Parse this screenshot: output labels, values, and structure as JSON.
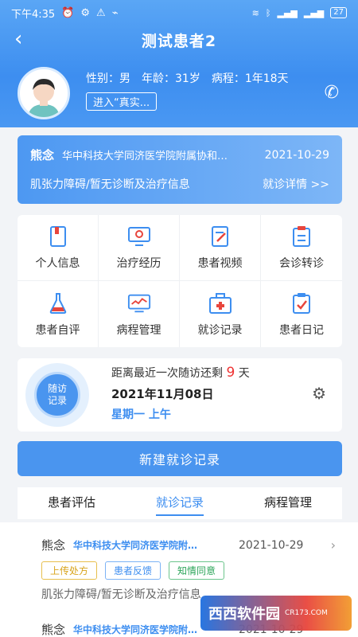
{
  "status_bar": {
    "time": "下午4:35",
    "battery": "27"
  },
  "nav": {
    "back_icon": "chevron-left-icon",
    "title": "测试患者2"
  },
  "patient": {
    "gender_label": "性别：男",
    "age_label": "年龄：31岁",
    "course_label": "病程：1年18天",
    "enter_button": "进入“真实..."
  },
  "latest_visit": {
    "name": "熊念",
    "hospital": "华中科技大学同济医学院附属协和…",
    "date": "2021-10-29",
    "diagnosis": "肌张力障碍/暂无诊断及治疗信息",
    "detail_link": "就诊详情 >>"
  },
  "menu": [
    {
      "label": "个人信息",
      "icon": "book-icon"
    },
    {
      "label": "治疗经历",
      "icon": "monitor-icon"
    },
    {
      "label": "患者视频",
      "icon": "edit-document-icon"
    },
    {
      "label": "会诊转诊",
      "icon": "clipboard-icon"
    },
    {
      "label": "患者自评",
      "icon": "flask-icon"
    },
    {
      "label": "病程管理",
      "icon": "chart-screen-icon"
    },
    {
      "label": "就诊记录",
      "icon": "medical-kit-icon"
    },
    {
      "label": "患者日记",
      "icon": "checklist-icon"
    }
  ],
  "followup": {
    "badge_line1": "随访",
    "badge_line2": "记录",
    "countdown_prefix": "距离最近一次随访还剩",
    "countdown_days": "9",
    "countdown_unit": "天",
    "date": "2021年11月08日",
    "weekday": "星期一 上午"
  },
  "new_record_button": "新建就诊记录",
  "tabs": [
    {
      "label": "患者评估",
      "active": false
    },
    {
      "label": "就诊记录",
      "active": true
    },
    {
      "label": "病程管理",
      "active": false
    }
  ],
  "records": [
    {
      "name": "熊念",
      "hospital": "华中科技大学同济医学院附…",
      "date": "2021-10-29",
      "tags": [
        "上传处方",
        "患者反馈",
        "知情同意"
      ],
      "diagnosis": "肌张力障碍/暂无诊断及治疗信息"
    },
    {
      "name": "熊念",
      "hospital": "华中科技大学同济医学院附…",
      "date": "2021-10-29"
    }
  ],
  "watermark": {
    "text": "西西软件园",
    "sub": "CR173.COM"
  },
  "colors": {
    "primary": "#3d8ef0",
    "header_gradient_top": "#5aa6f5",
    "countdown_red": "#e33"
  }
}
